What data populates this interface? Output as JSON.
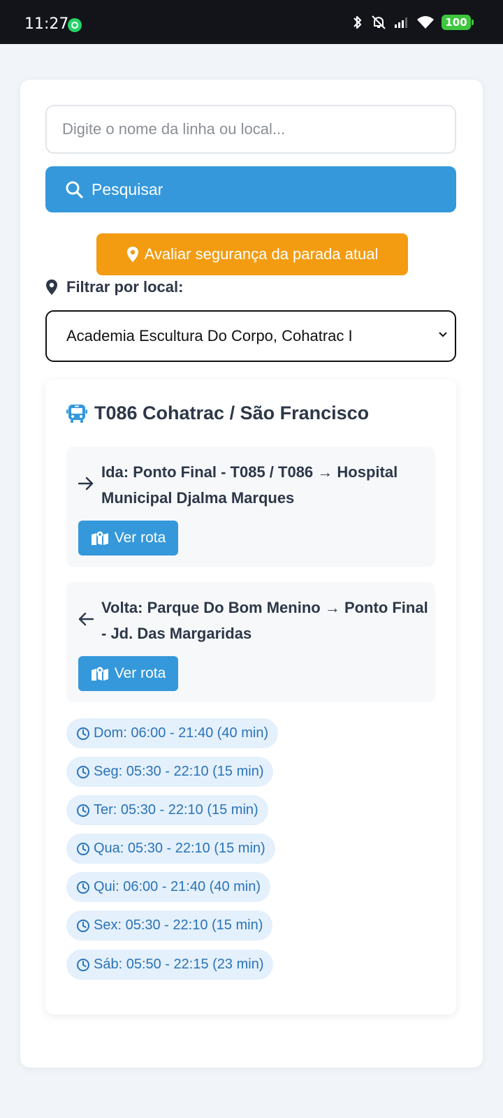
{
  "status_bar": {
    "time": "11:27",
    "battery": "100"
  },
  "search": {
    "placeholder": "Digite o nome da linha ou local...",
    "value": "",
    "button_label": "Pesquisar"
  },
  "safety_button_label": "Avaliar segurança da parada atual",
  "filter": {
    "label": "Filtrar por local:",
    "selected": "Academia Escultura Do Corpo, Cohatrac I"
  },
  "route": {
    "title": "T086 Cohatrac / São Francisco",
    "ida": {
      "text": "Ida: Ponto Final - T085 / T086 → Hospital Municipal Djalma Marques",
      "button_label": "Ver rota"
    },
    "volta": {
      "text": "Volta: Parque Do Bom Menino → Ponto Final - Jd. Das Margaridas",
      "button_label": "Ver rota"
    },
    "schedules": [
      "Dom: 06:00 - 21:40 (40 min)",
      "Seg: 05:30 - 22:10 (15 min)",
      "Ter: 05:30 - 22:10 (15 min)",
      "Qua: 05:30 - 22:10 (15 min)",
      "Qui: 06:00 - 21:40 (40 min)",
      "Sex: 05:30 - 22:10 (15 min)",
      "Sáb: 05:50 - 22:15 (23 min)"
    ]
  },
  "colors": {
    "primary": "#3498db",
    "warning": "#f39c12",
    "text": "#2d3748",
    "schedule_text": "#2a73b8",
    "schedule_bg": "#e4f0fb"
  },
  "icons": {
    "search": "search-icon",
    "pin": "map-pin-icon",
    "bus": "bus-icon",
    "map": "map-icon",
    "clock": "clock-icon",
    "arrow_right": "arrow-right-icon",
    "arrow_left": "arrow-left-icon"
  }
}
